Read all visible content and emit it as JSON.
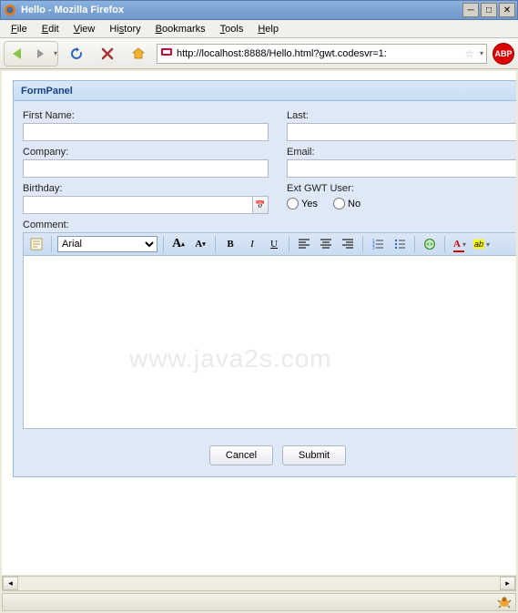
{
  "window": {
    "title": "Hello - Mozilla Firefox"
  },
  "menubar": {
    "file": "File",
    "edit": "Edit",
    "view": "View",
    "history": "History",
    "bookmarks": "Bookmarks",
    "tools": "Tools",
    "help": "Help"
  },
  "nav": {
    "url": "http://localhost:8888/Hello.html?gwt.codesvr=1:",
    "abp": "ABP"
  },
  "panel": {
    "title": "FormPanel"
  },
  "fields": {
    "first_name": {
      "label": "First Name:",
      "value": ""
    },
    "last": {
      "label": "Last:",
      "value": ""
    },
    "company": {
      "label": "Company:",
      "value": ""
    },
    "email": {
      "label": "Email:",
      "value": ""
    },
    "birthday": {
      "label": "Birthday:",
      "value": ""
    },
    "ext_user": {
      "label": "Ext GWT User:",
      "options": {
        "yes": "Yes",
        "no": "No"
      }
    },
    "comment": {
      "label": "Comment:"
    }
  },
  "editor": {
    "font_selected": "Arial",
    "buttons": {
      "source": "source-edit",
      "inc_font": "increase-font",
      "dec_font": "decrease-font",
      "bold": "B",
      "italic": "I",
      "underline": "U",
      "align_left": "left",
      "align_center": "center",
      "align_right": "right",
      "ol": "ordered-list",
      "ul": "unordered-list",
      "link": "link",
      "font_color": "A",
      "highlight": "ab"
    }
  },
  "buttons": {
    "cancel": "Cancel",
    "submit": "Submit"
  },
  "watermark": "www.java2s.com"
}
